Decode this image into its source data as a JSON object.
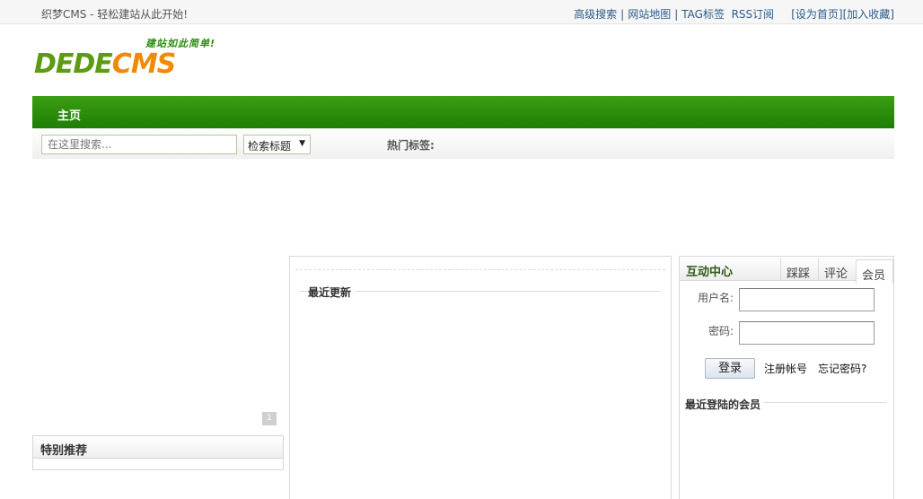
{
  "topbar": {
    "welcome": "织梦CMS - 轻松建站从此开始!",
    "links": [
      "高级搜索",
      "网站地图",
      "TAG标签",
      "RSS订阅"
    ],
    "set_home": "[设为首页]",
    "add_fav": "[加入收藏]"
  },
  "logo": {
    "slogan": "建站如此简单!",
    "dede": "DEDE",
    "cms": "CMS"
  },
  "nav": {
    "home": "主页"
  },
  "search": {
    "placeholder": "在这里搜索...",
    "select_value": "检索标题",
    "hot_tags_label": "热门标签:"
  },
  "left": {
    "pager_glyph": "1",
    "recommend_title": "特别推荐"
  },
  "middle": {
    "section_title": "最近更新"
  },
  "right": {
    "title": "互动中心",
    "tabs": [
      "踩踩",
      "评论",
      "会员"
    ],
    "username_label": "用户名:",
    "password_label": "密码:",
    "login_button": "登录",
    "register_link": "注册帐号",
    "forgot_link": "忘记密码?",
    "recent_members_title": "最近登陆的会员"
  },
  "colors": {
    "nav_green": "#1e7d06",
    "link_blue": "#2a5b8a",
    "logo_green": "#5c9b12",
    "logo_orange": "#f28a00"
  }
}
